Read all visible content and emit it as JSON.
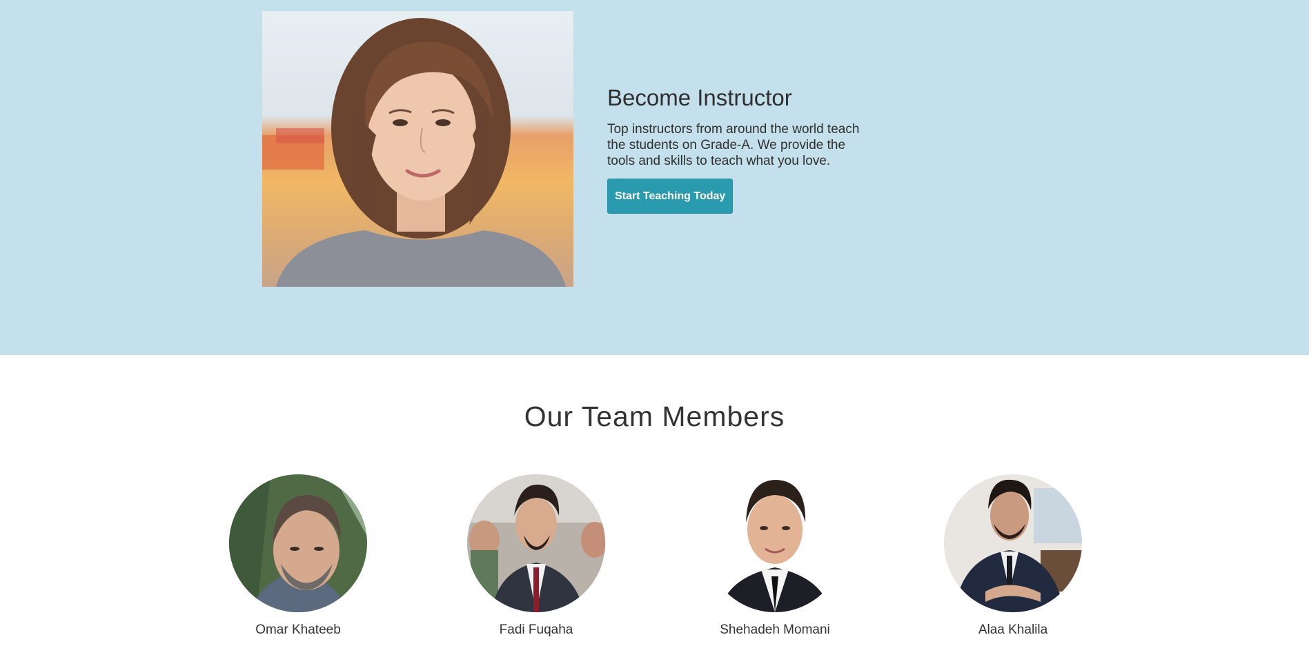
{
  "hero": {
    "title": "Become Instructor",
    "description": "Top instructors from around the world teach the students on Grade-A. We provide the tools and skills to teach what you love.",
    "cta_label": "Start Teaching Today",
    "background_color": "#c4e0ec",
    "cta_color": "#2a9aae"
  },
  "team": {
    "title": "Our Team Members",
    "members": [
      {
        "name": "Omar Khateeb"
      },
      {
        "name": "Fadi Fuqaha"
      },
      {
        "name": "Shehadeh Momani"
      },
      {
        "name": "Alaa Khalila"
      }
    ]
  }
}
